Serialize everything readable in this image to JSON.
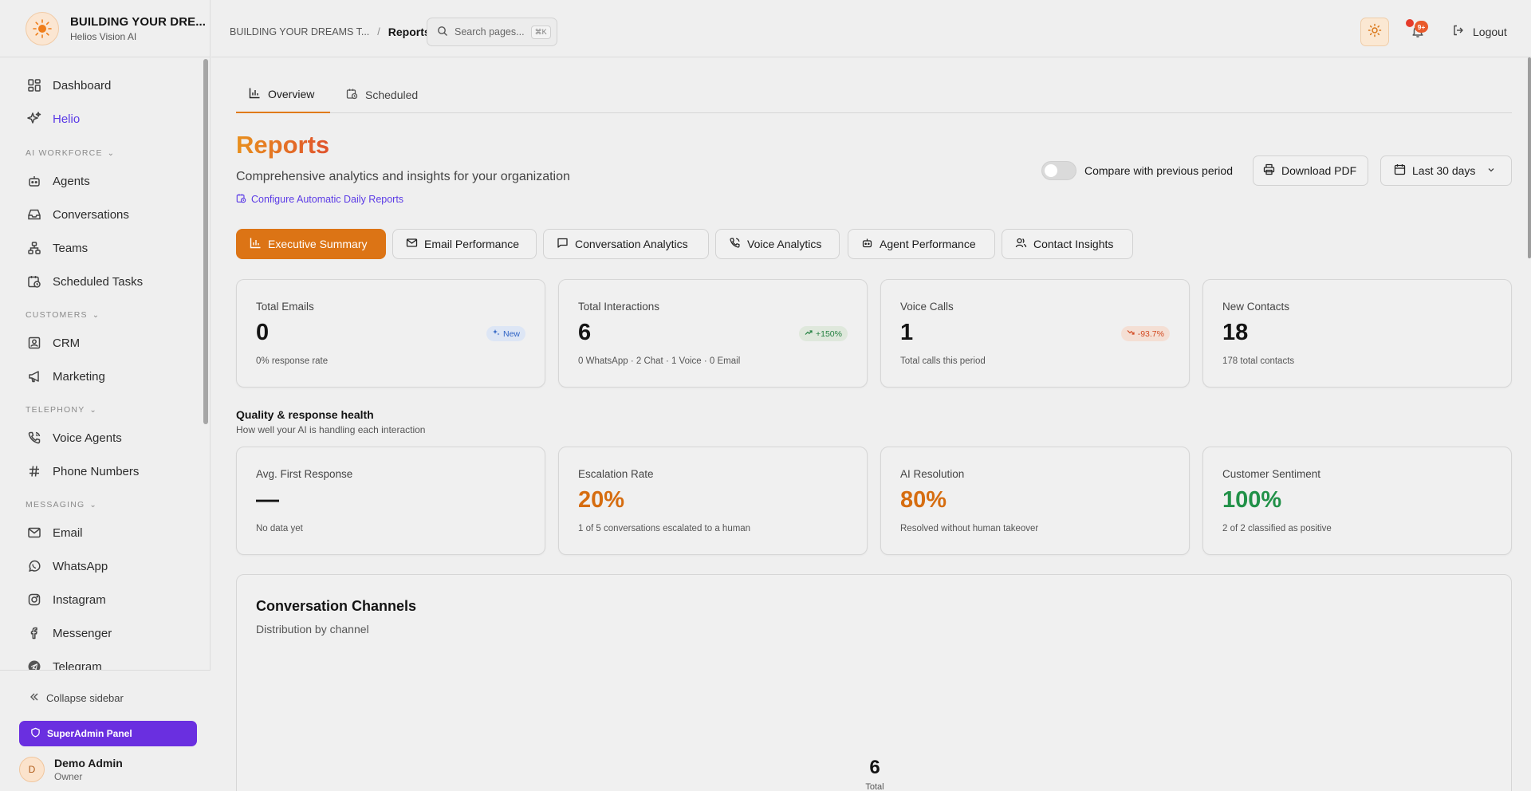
{
  "brand": {
    "title": "BUILDING YOUR DRE...",
    "subtitle": "Helios Vision AI"
  },
  "sidebar": {
    "dashboard": "Dashboard",
    "helio": "Helio",
    "section_ai": "AI WORKFORCE",
    "agents": "Agents",
    "conversations": "Conversations",
    "teams": "Teams",
    "scheduled_tasks": "Scheduled Tasks",
    "section_customers": "CUSTOMERS",
    "crm": "CRM",
    "marketing": "Marketing",
    "section_telephony": "TELEPHONY",
    "voice_agents": "Voice Agents",
    "phone_numbers": "Phone Numbers",
    "section_messaging": "MESSAGING",
    "email": "Email",
    "whatsapp": "WhatsApp",
    "instagram": "Instagram",
    "messenger": "Messenger",
    "telegram": "Telegram",
    "collapse": "Collapse sidebar",
    "superadmin": "SuperAdmin Panel",
    "user_initial": "D",
    "user_name": "Demo Admin",
    "user_role": "Owner"
  },
  "topbar": {
    "crumb_org": "BUILDING YOUR DREAMS T...",
    "crumb_sep": "/",
    "crumb_current": "Reports",
    "search_placeholder": "Search pages...",
    "search_kbd": "⌘K",
    "notif_badge": "9+",
    "logout": "Logout"
  },
  "tabs": {
    "overview": "Overview",
    "scheduled": "Scheduled"
  },
  "header": {
    "title": "Reports",
    "subtitle": "Comprehensive analytics and insights for your organization",
    "config_link": "Configure Automatic Daily Reports",
    "compare_label": "Compare with previous period",
    "compare_enabled": false,
    "download": "Download PDF",
    "range": "Last 30 days"
  },
  "report_tabs": {
    "executive": "Executive Summary",
    "email": "Email Performance",
    "conversation": "Conversation Analytics",
    "voice": "Voice Analytics",
    "agent": "Agent Performance",
    "contact": "Contact Insights"
  },
  "kpis": {
    "emails": {
      "label": "Total Emails",
      "value": "0",
      "badge": "New",
      "note": "0% response rate"
    },
    "interactions": {
      "label": "Total Interactions",
      "value": "6",
      "badge": "+150%",
      "note": "0 WhatsApp · 2 Chat · 1 Voice · 0 Email"
    },
    "calls": {
      "label": "Voice Calls",
      "value": "1",
      "badge": "-93.7%",
      "note": "Total calls this period"
    },
    "contacts": {
      "label": "New Contacts",
      "value": "18",
      "note": "178 total contacts"
    }
  },
  "quality": {
    "title": "Quality & response health",
    "subtitle": "How well your AI is handling each interaction",
    "first_response": {
      "label": "Avg. First Response",
      "value": "—",
      "note": "No data yet"
    },
    "escalation": {
      "label": "Escalation Rate",
      "value": "20%",
      "note": "1 of 5 conversations escalated to a human"
    },
    "resolution": {
      "label": "AI Resolution",
      "value": "80%",
      "note": "Resolved without human takeover"
    },
    "sentiment": {
      "label": "Customer Sentiment",
      "value": "100%",
      "note": "2 of 2 classified as positive"
    }
  },
  "channels": {
    "title": "Conversation Channels",
    "subtitle": "Distribution by channel",
    "total": "6",
    "total_label": "Total"
  },
  "colors": {
    "accent": "#dc7415",
    "brand_purple": "#6a2fe0",
    "positive": "#219148",
    "negative": "#d24a22"
  }
}
